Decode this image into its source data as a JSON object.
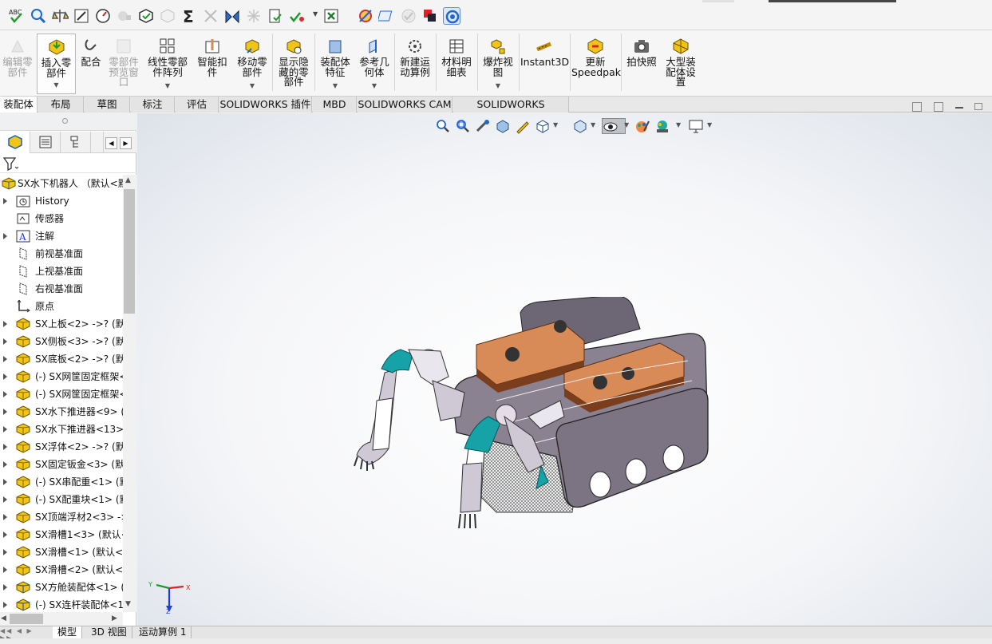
{
  "ribbon": {
    "items": [
      {
        "label": "编辑零\n部件",
        "icon": "edit-component-icon",
        "disabled": true
      },
      {
        "label": "插入零\n部件",
        "icon": "insert-component-icon",
        "dropdown": true
      },
      {
        "label": "配合",
        "icon": "mate-icon"
      },
      {
        "label": "零部件\n预览窗\n口",
        "icon": "component-preview-icon",
        "disabled": true
      },
      {
        "label": "线性零部\n件阵列",
        "icon": "linear-pattern-icon",
        "dropdown": true
      },
      {
        "label": "智能扣\n件",
        "icon": "smart-fasteners-icon"
      },
      {
        "label": "移动零\n部件",
        "icon": "move-component-icon",
        "dropdown": true
      },
      {
        "label": "显示隐\n藏的零\n部件",
        "icon": "show-hidden-icon"
      },
      {
        "label": "装配体\n特征",
        "icon": "assembly-features-icon",
        "dropdown": true
      },
      {
        "label": "参考几\n何体",
        "icon": "reference-geometry-icon",
        "dropdown": true
      },
      {
        "label": "新建运\n动算例",
        "icon": "new-motion-study-icon"
      },
      {
        "label": "材料明\n细表",
        "icon": "bill-of-materials-icon"
      },
      {
        "label": "爆炸视\n图",
        "icon": "exploded-view-icon",
        "dropdown": true
      },
      {
        "label": "Instant3D",
        "icon": "instant3d-icon"
      },
      {
        "label": "更新\nSpeedpak",
        "icon": "update-speedpak-icon"
      },
      {
        "label": "拍快照",
        "icon": "snapshot-icon"
      },
      {
        "label": "大型装\n配体设\n置",
        "icon": "large-assembly-icon"
      }
    ]
  },
  "tabs": [
    "装配体",
    "布局",
    "草图",
    "标注",
    "评估",
    "SOLIDWORKS 插件",
    "MBD",
    "SOLIDWORKS CAM",
    "SOLIDWORKS Inspection"
  ],
  "tree": {
    "root": "SX水下机器人 （默认<默",
    "items": [
      {
        "label": "History",
        "icon": "history-folder-icon",
        "expand": true
      },
      {
        "label": "传感器",
        "icon": "sensors-folder-icon",
        "expand": false
      },
      {
        "label": "注解",
        "icon": "annotations-icon",
        "expand": true
      },
      {
        "label": "前视基准面",
        "icon": "plane-icon",
        "expand": false
      },
      {
        "label": "上视基准面",
        "icon": "plane-icon",
        "expand": false
      },
      {
        "label": "右视基准面",
        "icon": "plane-icon",
        "expand": false
      },
      {
        "label": "原点",
        "icon": "origin-icon",
        "expand": false
      },
      {
        "label": "SX上板<2> ->? (默",
        "icon": "part-icon",
        "expand": true
      },
      {
        "label": "SX侧板<3> ->? (默",
        "icon": "part-icon",
        "expand": true
      },
      {
        "label": "SX底板<2> ->? (默",
        "icon": "part-icon",
        "expand": true
      },
      {
        "label": "(-) SX网筐固定框架<",
        "icon": "part-icon",
        "expand": true
      },
      {
        "label": "(-) SX网筐固定框架<",
        "icon": "part-icon",
        "expand": true
      },
      {
        "label": "SX水下推进器<9> (",
        "icon": "part-icon",
        "expand": true
      },
      {
        "label": "SX水下推进器<13>",
        "icon": "part-icon",
        "expand": true
      },
      {
        "label": "SX浮体<2> ->? (默",
        "icon": "part-icon",
        "expand": true
      },
      {
        "label": "SX固定钣金<3> (默",
        "icon": "part-icon",
        "expand": true
      },
      {
        "label": "(-) SX串配重<1> (默",
        "icon": "part-icon",
        "expand": true
      },
      {
        "label": "(-) SX配重块<1> (默",
        "icon": "part-icon",
        "expand": true
      },
      {
        "label": "SX顶端浮材2<3> ->",
        "icon": "part-icon",
        "expand": true
      },
      {
        "label": "SX滑槽1<3> (默认<",
        "icon": "part-icon",
        "expand": true
      },
      {
        "label": "SX滑槽<1> (默认<-",
        "icon": "part-icon",
        "expand": true
      },
      {
        "label": "SX滑槽<2> (默认<-",
        "icon": "part-icon",
        "expand": true
      },
      {
        "label": "SX方舱装配体<1> (",
        "icon": "subassembly-icon",
        "expand": true
      },
      {
        "label": "(-) SX连杆装配体<1",
        "icon": "subassembly-icon",
        "expand": true
      }
    ]
  },
  "bottom_tabs": [
    "模型",
    "3D 视图",
    "运动算例 1"
  ],
  "triad": {
    "x": "X",
    "y": "Y",
    "z": "Z"
  },
  "colors": {
    "accent": "#1f5fb4",
    "part_yellow": "#f0c419",
    "robot_orange": "#d88a57",
    "robot_teal": "#16a3a8",
    "robot_plate": "#7c7383"
  }
}
